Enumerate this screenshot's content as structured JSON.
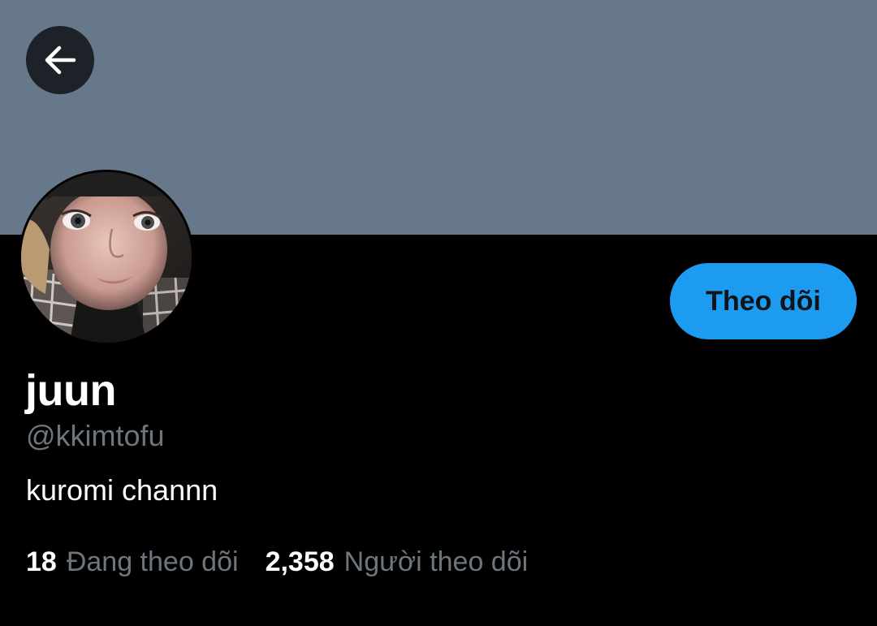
{
  "header": {
    "back_icon": "arrow-left-icon",
    "banner_color": "#66788a"
  },
  "profile": {
    "display_name": "juun",
    "handle": "@kkimtofu",
    "bio": "kuromi channn",
    "avatar_alt": "profile photo"
  },
  "follow_button": {
    "label": "Theo dõi",
    "color": "#1d9bf0"
  },
  "stats": {
    "following_count": "18",
    "following_label": "Đang theo dõi",
    "followers_count": "2,358",
    "followers_label": "Người theo dõi"
  },
  "colors": {
    "background": "#000000",
    "secondary_text": "#6e767d",
    "primary_text": "#ffffff"
  }
}
